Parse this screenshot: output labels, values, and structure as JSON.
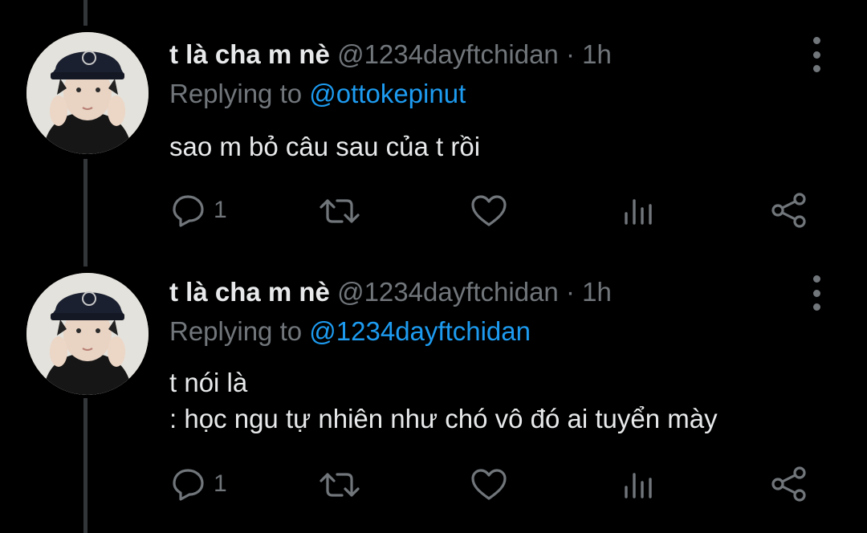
{
  "colors": {
    "background": "#000000",
    "primary_text": "#e7e9ea",
    "secondary_text": "#71767b",
    "link": "#1d9bf0",
    "thread_line": "#333639"
  },
  "icons": {
    "reply": "speech-bubble-icon",
    "retweet": "retweet-arrows-icon",
    "like": "heart-icon",
    "views": "bar-chart-icon",
    "share": "share-icon",
    "more": "vertical-dots-icon"
  },
  "tweets": [
    {
      "display_name": "t là cha m nè",
      "handle": "@1234dayftchidan",
      "separator": "·",
      "time": "1h",
      "replying_prefix": "Replying to",
      "replying_to": "@ottokepinut",
      "text": "sao m bỏ câu sau của t rồi",
      "reply_count": "1"
    },
    {
      "display_name": "t là cha m nè",
      "handle": "@1234dayftchidan",
      "separator": "·",
      "time": "1h",
      "replying_prefix": "Replying to",
      "replying_to": "@1234dayftchidan",
      "text": "t nói là\n: học ngu tự nhiên như chó vô đó ai tuyển mày",
      "reply_count": "1"
    }
  ]
}
